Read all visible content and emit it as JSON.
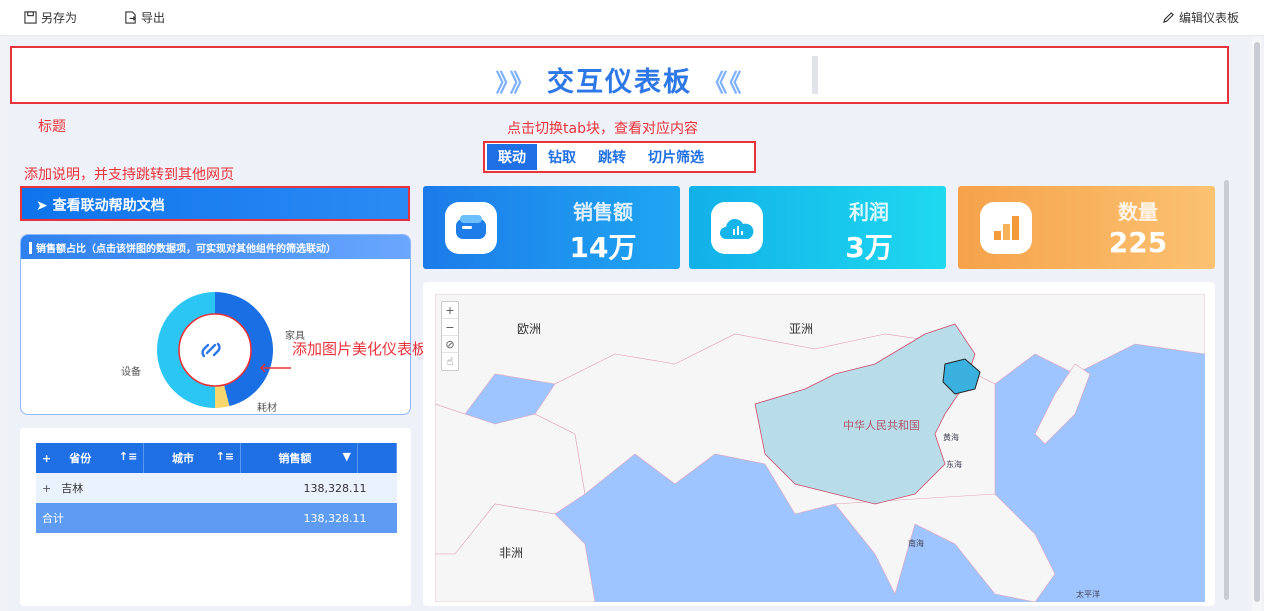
{
  "toolbar": {
    "save_as": "另存为",
    "export": "导出",
    "edit": "编辑仪表板"
  },
  "title": {
    "left_arrows": "》》",
    "text": "交互仪表板",
    "right_arrows": "《《"
  },
  "annotations": {
    "title": "标题",
    "tabs": "点击切换tab块，查看对应内容",
    "help": "添加说明，并支持跳转到其他网页",
    "image": "添加图片美化仪表板"
  },
  "tabs": [
    {
      "label": "联动",
      "active": true
    },
    {
      "label": "钻取",
      "active": false
    },
    {
      "label": "跳转",
      "active": false
    },
    {
      "label": "切片筛选",
      "active": false
    }
  ],
  "help_button": "➤ 查看联动帮助文档",
  "kpis": [
    {
      "label": "销售额",
      "value": "14万",
      "gradient": [
        "#1c7be9",
        "#1fa6f2"
      ],
      "icon": "wallet-icon"
    },
    {
      "label": "利润",
      "value": "3万",
      "gradient": [
        "#12b0e8",
        "#1ed9f0"
      ],
      "icon": "chart-cloud-icon"
    },
    {
      "label": "数量",
      "value": "225",
      "gradient": [
        "#f6a24a",
        "#fbc272"
      ],
      "icon": "bar-chart-icon"
    }
  ],
  "pie": {
    "header": "销售额占比（点击该饼图的数据项，可实现对其他组件的筛选联动）",
    "slices": [
      {
        "label": "家具",
        "value": 46,
        "color": "#1b6fe4"
      },
      {
        "label": "耗材",
        "value": 4,
        "color": "#f5d76e"
      },
      {
        "label": "设备",
        "value": 50,
        "color": "#2cc6f4"
      }
    ]
  },
  "table": {
    "headers": [
      "省份",
      "城市",
      "销售额"
    ],
    "plus": "+",
    "rows": [
      {
        "province": "吉林",
        "city": "",
        "sales": "138,328.11"
      }
    ],
    "total": {
      "label": "合计",
      "sales": "138,328.11"
    }
  },
  "map": {
    "controls": [
      "+",
      "−",
      "⊘",
      "☝"
    ],
    "labels": {
      "europe": "欧洲",
      "asia": "亚洲",
      "africa": "非洲",
      "china": "中华人民共和国",
      "yellow_sea": "黄海",
      "east_sea": "东海",
      "south_sea": "南海",
      "pacific": "太平洋"
    }
  }
}
